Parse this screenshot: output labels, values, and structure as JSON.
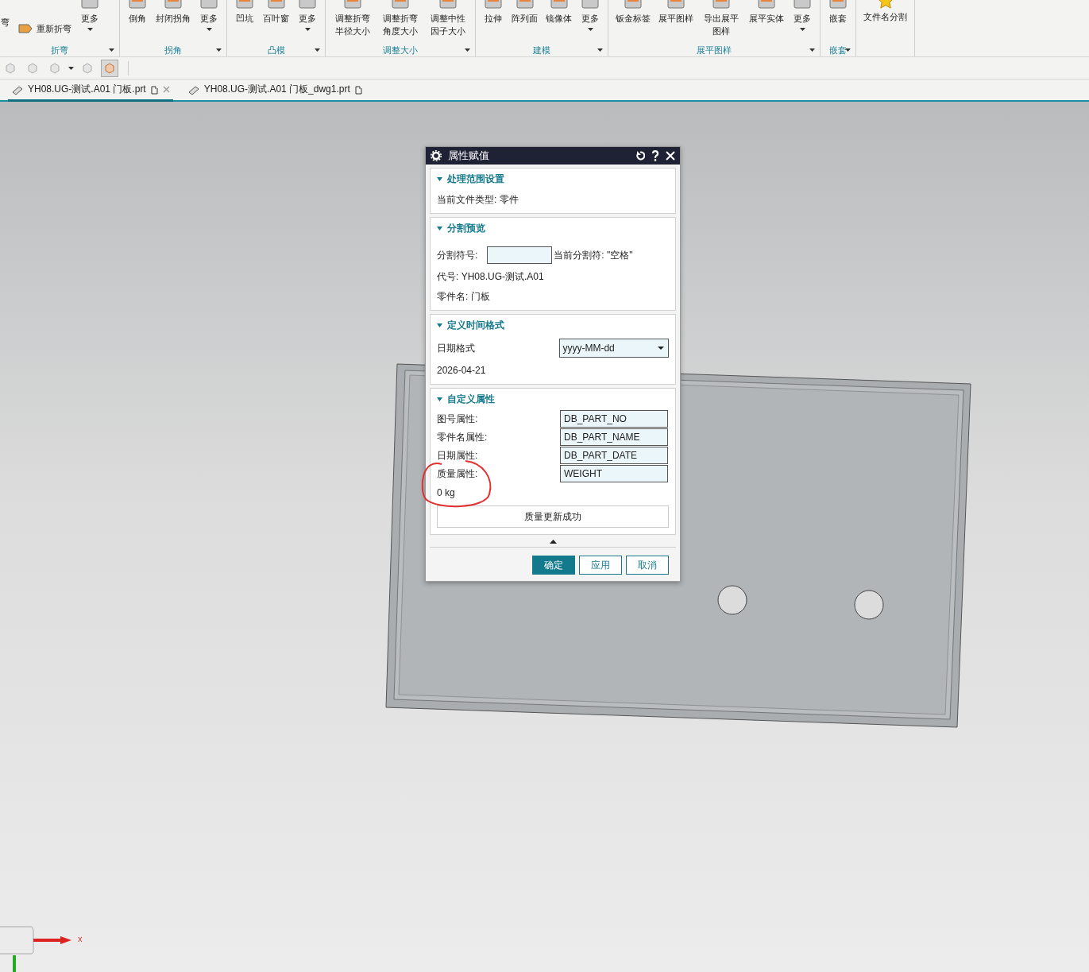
{
  "ribbon": {
    "groups": [
      {
        "label": "折弯",
        "buttons": [
          {
            "kind": "cut",
            "label": "弯"
          },
          {
            "kind": "small",
            "label": "重新折弯"
          },
          {
            "kind": "more",
            "label": "更多"
          }
        ]
      },
      {
        "label": "拐角",
        "buttons": [
          {
            "kind": "large",
            "label": "倒角"
          },
          {
            "kind": "large",
            "label": "封闭拐角"
          },
          {
            "kind": "more",
            "label": "更多"
          }
        ]
      },
      {
        "label": "凸模",
        "buttons": [
          {
            "kind": "large",
            "label": "凹坑"
          },
          {
            "kind": "large",
            "label": "百叶窗"
          },
          {
            "kind": "more",
            "label": "更多"
          }
        ]
      },
      {
        "label": "调整大小",
        "buttons": [
          {
            "kind": "large",
            "label": "调整折弯半径大小"
          },
          {
            "kind": "large",
            "label": "调整折弯角度大小"
          },
          {
            "kind": "large",
            "label": "调整中性因子大小"
          }
        ]
      },
      {
        "label": "建模",
        "buttons": [
          {
            "kind": "large",
            "label": "拉伸"
          },
          {
            "kind": "large",
            "label": "阵列面"
          },
          {
            "kind": "large",
            "label": "镜像体"
          },
          {
            "kind": "more",
            "label": "更多"
          }
        ]
      },
      {
        "label": "展平图样",
        "buttons": [
          {
            "kind": "large",
            "label": "钣金标签"
          },
          {
            "kind": "large",
            "label": "展平图样"
          },
          {
            "kind": "large",
            "label": "导出展平图样"
          },
          {
            "kind": "large",
            "label": "展平实体"
          },
          {
            "kind": "more",
            "label": "更多"
          }
        ]
      },
      {
        "label": "嵌套",
        "buttons": [
          {
            "kind": "large",
            "label": "嵌套"
          }
        ]
      },
      {
        "buttons": [
          {
            "kind": "star",
            "label": "文件名分割"
          }
        ]
      }
    ]
  },
  "quick_toolbar": [
    {
      "selected": false
    },
    {
      "selected": false
    },
    {
      "selected": false
    },
    {
      "selected": false
    },
    {
      "selected": true
    }
  ],
  "tabs": [
    {
      "label": "YH08.UG-测试.A01 门板.prt",
      "selected": true,
      "closable": true
    },
    {
      "label": "YH08.UG-测试.A01 门板_dwg1.prt",
      "selected": false,
      "closable": false
    }
  ],
  "dialog": {
    "title": "属性赋值",
    "sections": [
      {
        "title": "处理范围设置",
        "expanded": true,
        "rows": [
          {
            "kind": "text",
            "text": "当前文件类型: 零件"
          }
        ]
      },
      {
        "title": "分割预览",
        "expanded": true,
        "rows": [
          {
            "kind": "inline_input",
            "label": "分割符号:",
            "note": "当前分割符: \"空格\""
          },
          {
            "kind": "text",
            "text": "代号: YH08.UG-测试.A01"
          },
          {
            "kind": "text",
            "text": "零件名: 门板"
          }
        ]
      },
      {
        "title": "定义时间格式",
        "expanded": true,
        "rows": [
          {
            "kind": "select",
            "label": "日期格式",
            "value": "yyyy-MM-dd"
          },
          {
            "kind": "text",
            "text": "2026-04-21"
          }
        ]
      },
      {
        "title": "自定义属性",
        "expanded": true,
        "rows": [
          {
            "kind": "field",
            "label": "图号属性:",
            "value": "DB_PART_NO"
          },
          {
            "kind": "field",
            "label": "零件名属性:",
            "value": "DB_PART_NAME"
          },
          {
            "kind": "field",
            "label": "日期属性:",
            "value": "DB_PART_DATE"
          },
          {
            "kind": "field",
            "label": "质量属性:",
            "value": "WEIGHT"
          },
          {
            "kind": "text",
            "text": "0 kg"
          },
          {
            "kind": "button",
            "text": "质量更新成功"
          }
        ]
      }
    ],
    "buttons": [
      {
        "label": "确定",
        "primary": true
      },
      {
        "label": "应用",
        "primary": false
      },
      {
        "label": "取消",
        "primary": false
      }
    ]
  },
  "axis": {
    "label": "x"
  }
}
